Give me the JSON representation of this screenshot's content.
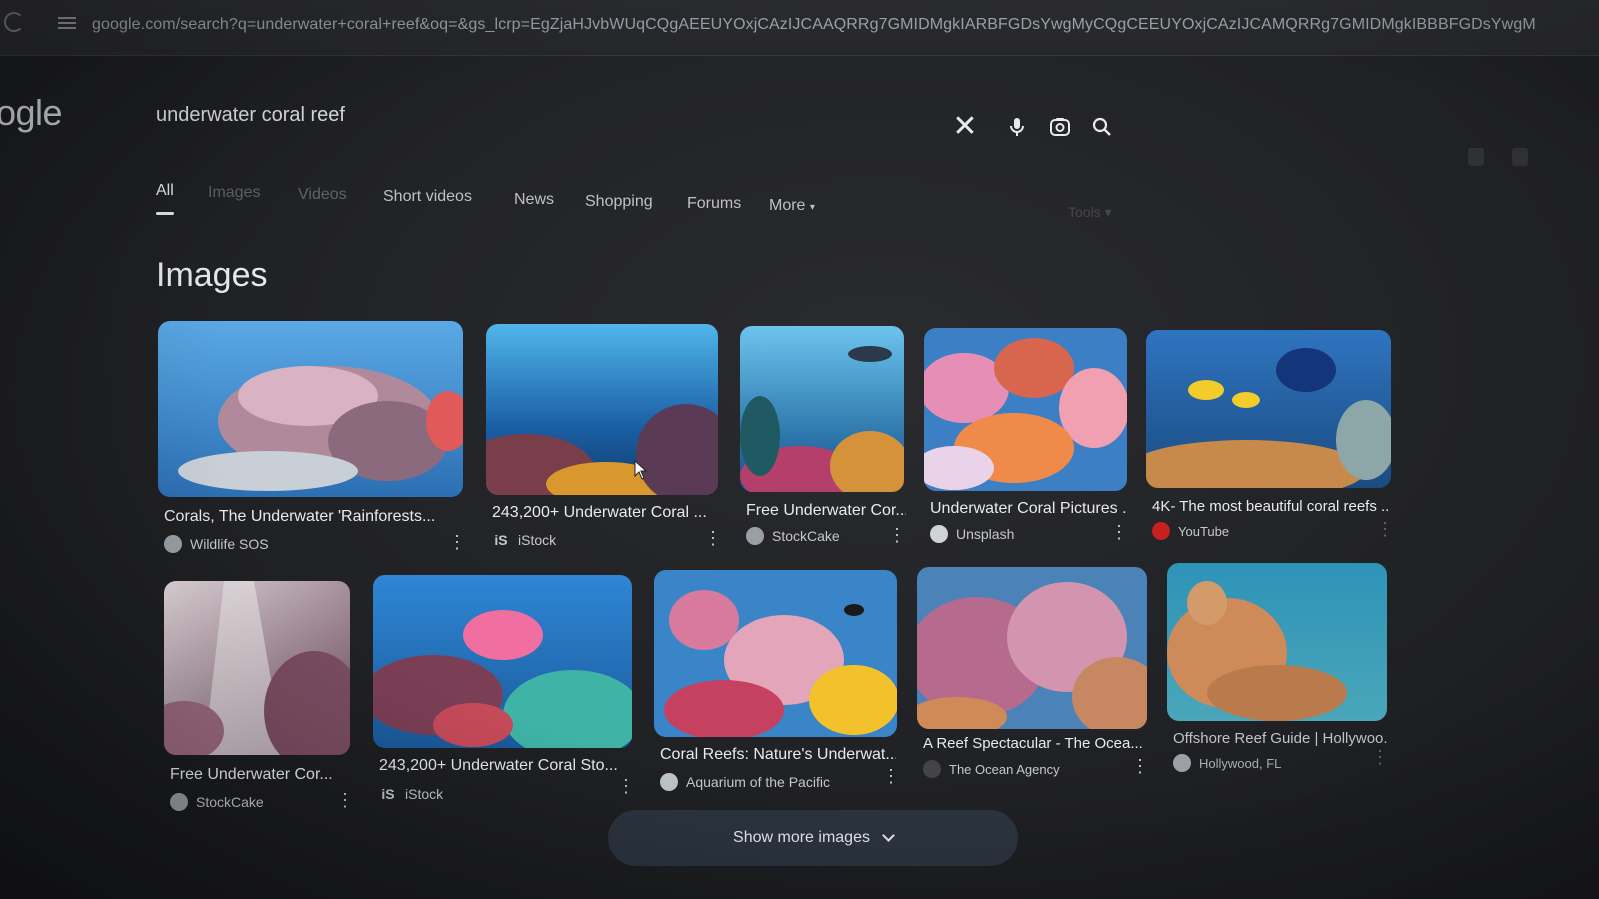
{
  "browser": {
    "url": "google.com/search?q=underwater+coral+reef&oq=&gs_lcrp=EgZjaHJvbWUqCQgAEEUYOxjCAzIJCAAQRRg7GMIDMgkIARBFGDsYwgMyCQgCEEUYOxjCAzIJCAMQRRg7GMIDMgkIBBBFGDsYwgM"
  },
  "logo": {
    "text": "ogle"
  },
  "search": {
    "query": "underwater coral reef",
    "icons": [
      "close-icon",
      "mic-icon",
      "lens-icon",
      "search-icon"
    ]
  },
  "tabs": [
    {
      "label": "All",
      "active": true
    },
    {
      "label": "Images"
    },
    {
      "label": "Videos"
    },
    {
      "label": "Short videos"
    },
    {
      "label": "News"
    },
    {
      "label": "Shopping"
    },
    {
      "label": "Forums"
    },
    {
      "label": "More"
    }
  ],
  "tools_label": "Tools",
  "images_heading": "Images",
  "results_row1": [
    {
      "title": "Corals, The Underwater 'Rainforests...",
      "source": "Wildlife SOS",
      "source_icon": "globe-icon"
    },
    {
      "title": "243,200+ Underwater Coral ...",
      "source": "iStock",
      "source_icon": "istock-icon"
    },
    {
      "title": "Free Underwater Cor...",
      "source": "StockCake",
      "source_icon": "globe-icon"
    },
    {
      "title": "Underwater Coral Pictures ...",
      "source": "Unsplash",
      "source_icon": "unsplash-icon"
    },
    {
      "title": "4K- The most beautiful coral reefs ...",
      "source": "YouTube",
      "source_icon": "youtube-icon"
    }
  ],
  "results_row2": [
    {
      "title": "Free Underwater Cor...",
      "source": "StockCake",
      "source_icon": "globe-icon"
    },
    {
      "title": "243,200+ Underwater Coral Sto...",
      "source": "iStock",
      "source_icon": "istock-icon"
    },
    {
      "title": "Coral Reefs: Nature's Underwat...",
      "source": "Aquarium of the Pacific",
      "source_icon": "globe-icon"
    },
    {
      "title": "A Reef Spectacular - The Ocea...",
      "source": "The Ocean Agency",
      "source_icon": "globe-icon"
    },
    {
      "title": "Offshore Reef Guide | Hollywoo...",
      "source": "Hollywood, FL",
      "source_icon": "globe-icon"
    }
  ],
  "show_more_label": "Show more images",
  "istock_mark": "iS"
}
